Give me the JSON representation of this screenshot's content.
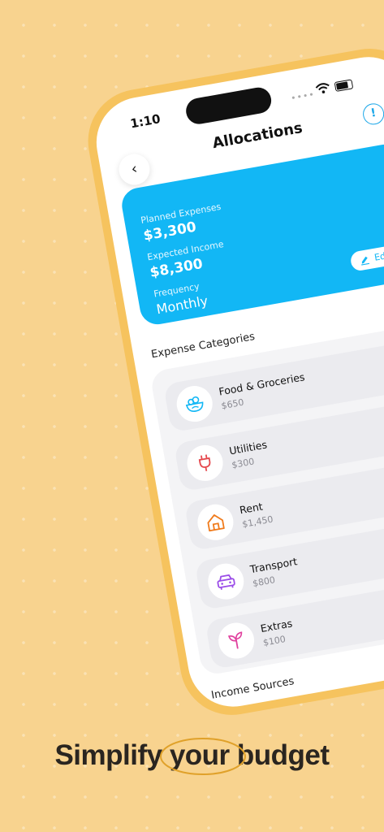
{
  "status": {
    "time": "1:10"
  },
  "header": {
    "title": "Allocations"
  },
  "summary": {
    "planned_label": "Planned Expenses",
    "planned_value": "$3,300",
    "income_label": "Expected Income",
    "income_value": "$8,300",
    "frequency_label": "Frequency",
    "frequency_value": "Monthly",
    "edit_label": "Edit"
  },
  "expense_categories": {
    "title": "Expense Categories",
    "items": [
      {
        "name": "Food & Groceries",
        "amount": "$650",
        "icon": "salad-bowl-icon",
        "color": "#12b7f5"
      },
      {
        "name": "Utilities",
        "amount": "$300",
        "icon": "plug-icon",
        "color": "#e5484d"
      },
      {
        "name": "Rent",
        "amount": "$1,450",
        "icon": "house-icon",
        "color": "#f07a1a"
      },
      {
        "name": "Transport",
        "amount": "$800",
        "icon": "car-icon",
        "color": "#9b4de8"
      },
      {
        "name": "Extras",
        "amount": "$100",
        "icon": "sprout-icon",
        "color": "#e0409e"
      }
    ]
  },
  "income_sources": {
    "title": "Income Sources"
  },
  "tagline": {
    "part1": "Simplify",
    "part2": "your",
    "part3": "budget"
  },
  "colors": {
    "accent": "#12b7f5",
    "background": "#f8d38f",
    "frame": "#f6c35e",
    "fab": "#6b5bd6"
  }
}
